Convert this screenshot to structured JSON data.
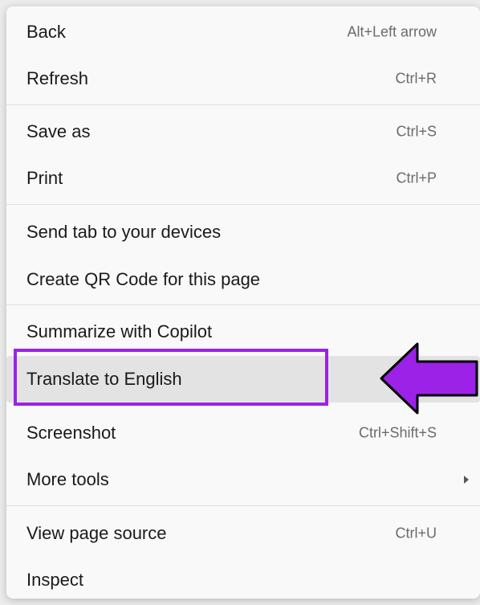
{
  "menu": {
    "items": [
      {
        "label": "Back",
        "shortcut": "Alt+Left arrow"
      },
      {
        "label": "Refresh",
        "shortcut": "Ctrl+R"
      },
      {
        "label": "Save as",
        "shortcut": "Ctrl+S"
      },
      {
        "label": "Print",
        "shortcut": "Ctrl+P"
      },
      {
        "label": "Send tab to your devices",
        "shortcut": ""
      },
      {
        "label": "Create QR Code for this page",
        "shortcut": ""
      },
      {
        "label": "Summarize with Copilot",
        "shortcut": ""
      },
      {
        "label": "Translate to English",
        "shortcut": ""
      },
      {
        "label": "Screenshot",
        "shortcut": "Ctrl+Shift+S"
      },
      {
        "label": "More tools",
        "shortcut": ""
      },
      {
        "label": "View page source",
        "shortcut": "Ctrl+U"
      },
      {
        "label": "Inspect",
        "shortcut": ""
      }
    ]
  },
  "annotation": {
    "highlight_color": "#9b22e6",
    "arrow_icon": "left-arrow-icon"
  },
  "colors": {
    "menu_background": "#f9f9f9",
    "hover_background": "#e3e3e3",
    "text": "#1a1a1a",
    "shortcut_text": "#6b6b6b",
    "separator": "#e0e0e0"
  }
}
